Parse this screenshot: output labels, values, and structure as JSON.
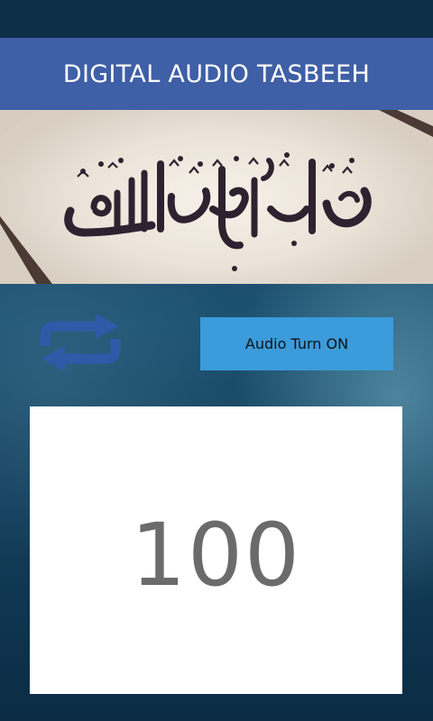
{
  "app": {
    "title": "DIGITAL AUDIO TASBEEH"
  },
  "banner": {
    "description_icon": "astaghfirullah-calligraphy-image"
  },
  "controls": {
    "repeat_icon": "repeat-icon",
    "audio_button_label": "Audio Turn ON"
  },
  "counter": {
    "value": "100"
  },
  "colors": {
    "title_bar": "#3f5fa6",
    "audio_button": "#3b9bdb",
    "repeat_icon": "#2e5aa8",
    "counter_text": "#6b6b6b"
  }
}
